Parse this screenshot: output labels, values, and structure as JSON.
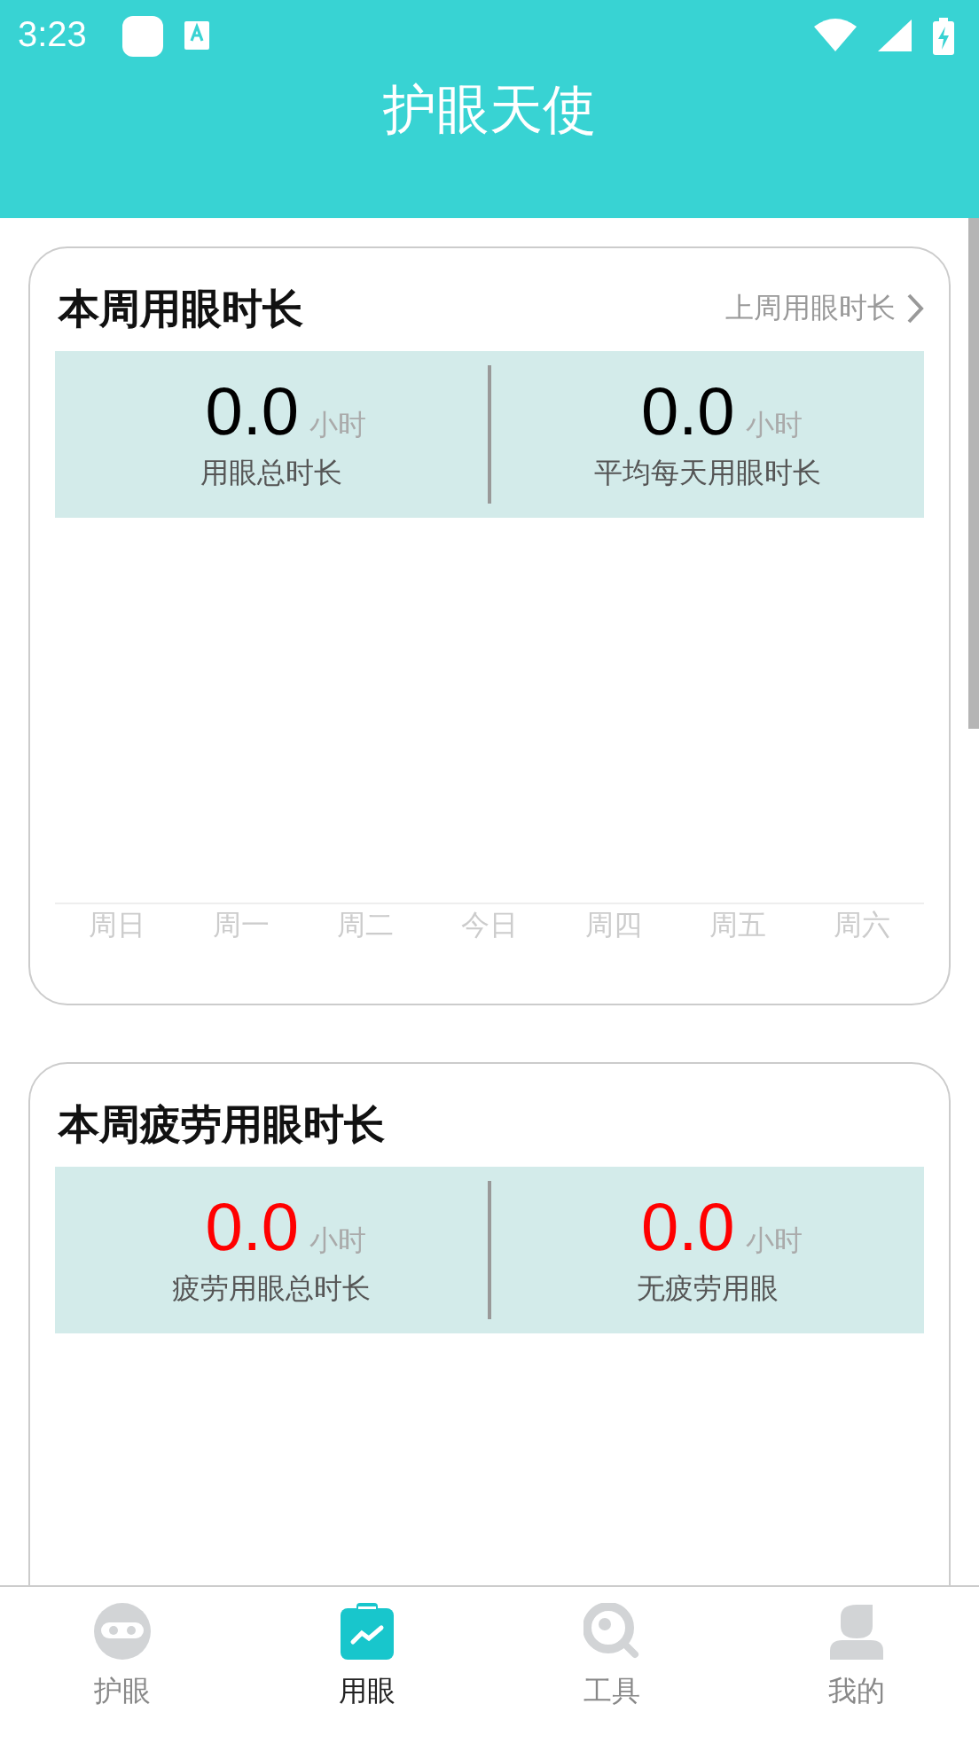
{
  "status_bar": {
    "time": "3:23"
  },
  "header": {
    "title": "护眼天使"
  },
  "cards": [
    {
      "title": "本周用眼时长",
      "link": "上周用眼时长",
      "warning": false,
      "stats": [
        {
          "value": "0.0",
          "unit": "小时",
          "label": "用眼总时长"
        },
        {
          "value": "0.0",
          "unit": "小时",
          "label": "平均每天用眼时长"
        }
      ],
      "axis_labels": [
        "周日",
        "周一",
        "周二",
        "今日",
        "周四",
        "周五",
        "周六"
      ]
    },
    {
      "title": "本周疲劳用眼时长",
      "warning": true,
      "stats": [
        {
          "value": "0.0",
          "unit": "小时",
          "label": "疲劳用眼总时长"
        },
        {
          "value": "0.0",
          "unit": "小时",
          "label": "无疲劳用眼"
        }
      ]
    }
  ],
  "tabs": [
    {
      "label": "护眼",
      "selected": false
    },
    {
      "label": "用眼",
      "selected": true
    },
    {
      "label": "工具",
      "selected": false
    },
    {
      "label": "我的",
      "selected": false
    }
  ]
}
